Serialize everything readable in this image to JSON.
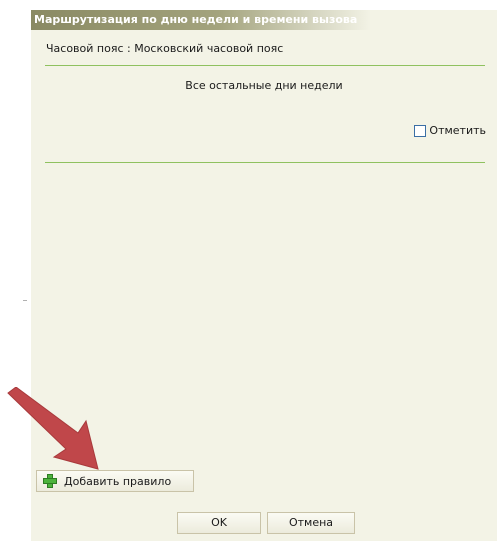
{
  "dialog": {
    "title": "Маршрутизация по дню недели и времени вызова",
    "timezone": "Часовой пояс : Московский часовой пояс",
    "days_heading": "Все остальные дни недели",
    "mark": {
      "label": "Отметить",
      "checked": false
    },
    "add_rule_label": "Добавить правило",
    "ok_label": "OK",
    "cancel_label": "Отмена"
  },
  "colors": {
    "dialog_bg": "#f3f3e6",
    "divider": "#8fc15f",
    "arrow": "#c0474a"
  },
  "icons": {
    "add": "plus-icon",
    "annotation": "arrow-annotation-icon"
  }
}
